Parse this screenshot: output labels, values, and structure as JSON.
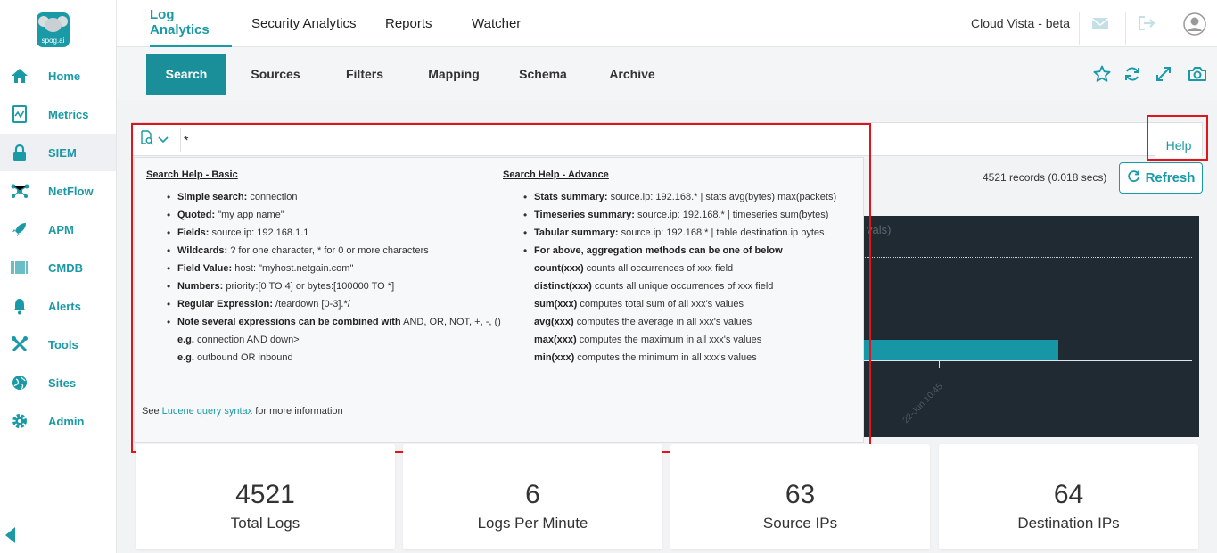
{
  "app": {
    "logo_text": "spog.ai",
    "brand": "Cloud Vista - beta"
  },
  "sidebar": {
    "items": [
      {
        "label": "Home",
        "icon": "home-icon"
      },
      {
        "label": "Metrics",
        "icon": "metrics-icon"
      },
      {
        "label": "SIEM",
        "icon": "lock-icon",
        "active": true
      },
      {
        "label": "NetFlow",
        "icon": "netflow-icon"
      },
      {
        "label": "APM",
        "icon": "rocket-icon"
      },
      {
        "label": "CMDB",
        "icon": "barcode-icon"
      },
      {
        "label": "Alerts",
        "icon": "bell-icon"
      },
      {
        "label": "Tools",
        "icon": "tools-icon"
      },
      {
        "label": "Sites",
        "icon": "globe-icon"
      },
      {
        "label": "Admin",
        "icon": "gear-icon"
      }
    ]
  },
  "topnav": {
    "tabs": [
      "Log Analytics",
      "Security Analytics",
      "Reports",
      "Watcher"
    ]
  },
  "subnav": {
    "tabs": [
      "Search",
      "Sources",
      "Filters",
      "Mapping",
      "Schema",
      "Archive"
    ]
  },
  "search": {
    "query": "*",
    "help_label": "Help"
  },
  "results": {
    "records": "4521 records (0.018 secs)",
    "refresh_label": "Refresh"
  },
  "chart": {
    "title_fragment": "vals)",
    "x_tick": "22-Jun 10:45"
  },
  "help": {
    "basic_title": "Search Help - Basic",
    "basic": [
      {
        "k": "Simple search:",
        "v": " connection",
        "bullet": true
      },
      {
        "k": "Quoted:",
        "v": " \"my app name\"",
        "bullet": true
      },
      {
        "k": "Fields:",
        "v": " source.ip: 192.168.1.1",
        "bullet": true
      },
      {
        "k": "Wildcards:",
        "v": " ? for one character, * for 0 or more characters",
        "bullet": true
      },
      {
        "k": "Field Value:",
        "v": " host: \"myhost.netgain.com\"",
        "bullet": true
      },
      {
        "k": "Numbers:",
        "v": " priority:[0 TO 4] or bytes:[100000 TO *]",
        "bullet": true
      },
      {
        "k": "Regular Expression:",
        "v": " /teardown [0-3].*/",
        "bullet": true
      },
      {
        "k": "Note several expressions can be combined with",
        "v": " AND, OR, NOT, +, -, ()",
        "bullet": true
      },
      {
        "k": "e.g.",
        "v": " connection AND down>",
        "bullet": false
      },
      {
        "k": "e.g.",
        "v": " outbound OR inbound",
        "bullet": false
      }
    ],
    "advance_title": "Search Help - Advance",
    "advance": [
      {
        "k": "Stats summary:",
        "v": " source.ip: 192.168.* | stats avg(bytes) max(packets)",
        "bullet": true
      },
      {
        "k": "Timeseries summary:",
        "v": " source.ip: 192.168.* | timeseries sum(bytes)",
        "bullet": true
      },
      {
        "k": "Tabular summary:",
        "v": " source.ip: 192.168.* | table destination.ip bytes",
        "bullet": true
      },
      {
        "k": "For above, aggregation methods can be one of below",
        "v": "",
        "bullet": true
      },
      {
        "k": "count(xxx)",
        "v": " counts all occurrences of xxx field",
        "bullet": false
      },
      {
        "k": "distinct(xxx)",
        "v": " counts all unique occurrences of xxx field",
        "bullet": false
      },
      {
        "k": "sum(xxx)",
        "v": " computes total sum of all xxx's values",
        "bullet": false
      },
      {
        "k": "avg(xxx)",
        "v": " computes the average in all xxx's values",
        "bullet": false
      },
      {
        "k": "max(xxx)",
        "v": " computes the maximum in all xxx's values",
        "bullet": false
      },
      {
        "k": "min(xxx)",
        "v": " computes the minimum in all xxx's values",
        "bullet": false
      }
    ],
    "footer_pre": "See ",
    "footer_link": "Lucene query syntax",
    "footer_post": " for more information"
  },
  "stats": [
    {
      "value": "4521",
      "label": "Total Logs"
    },
    {
      "value": "6",
      "label": "Logs Per Minute"
    },
    {
      "value": "63",
      "label": "Source IPs"
    },
    {
      "value": "64",
      "label": "Destination IPs"
    }
  ],
  "colors": {
    "accent": "#1a9aa6",
    "highlight": "#e0151b",
    "chart_bg": "#1f2a33"
  }
}
